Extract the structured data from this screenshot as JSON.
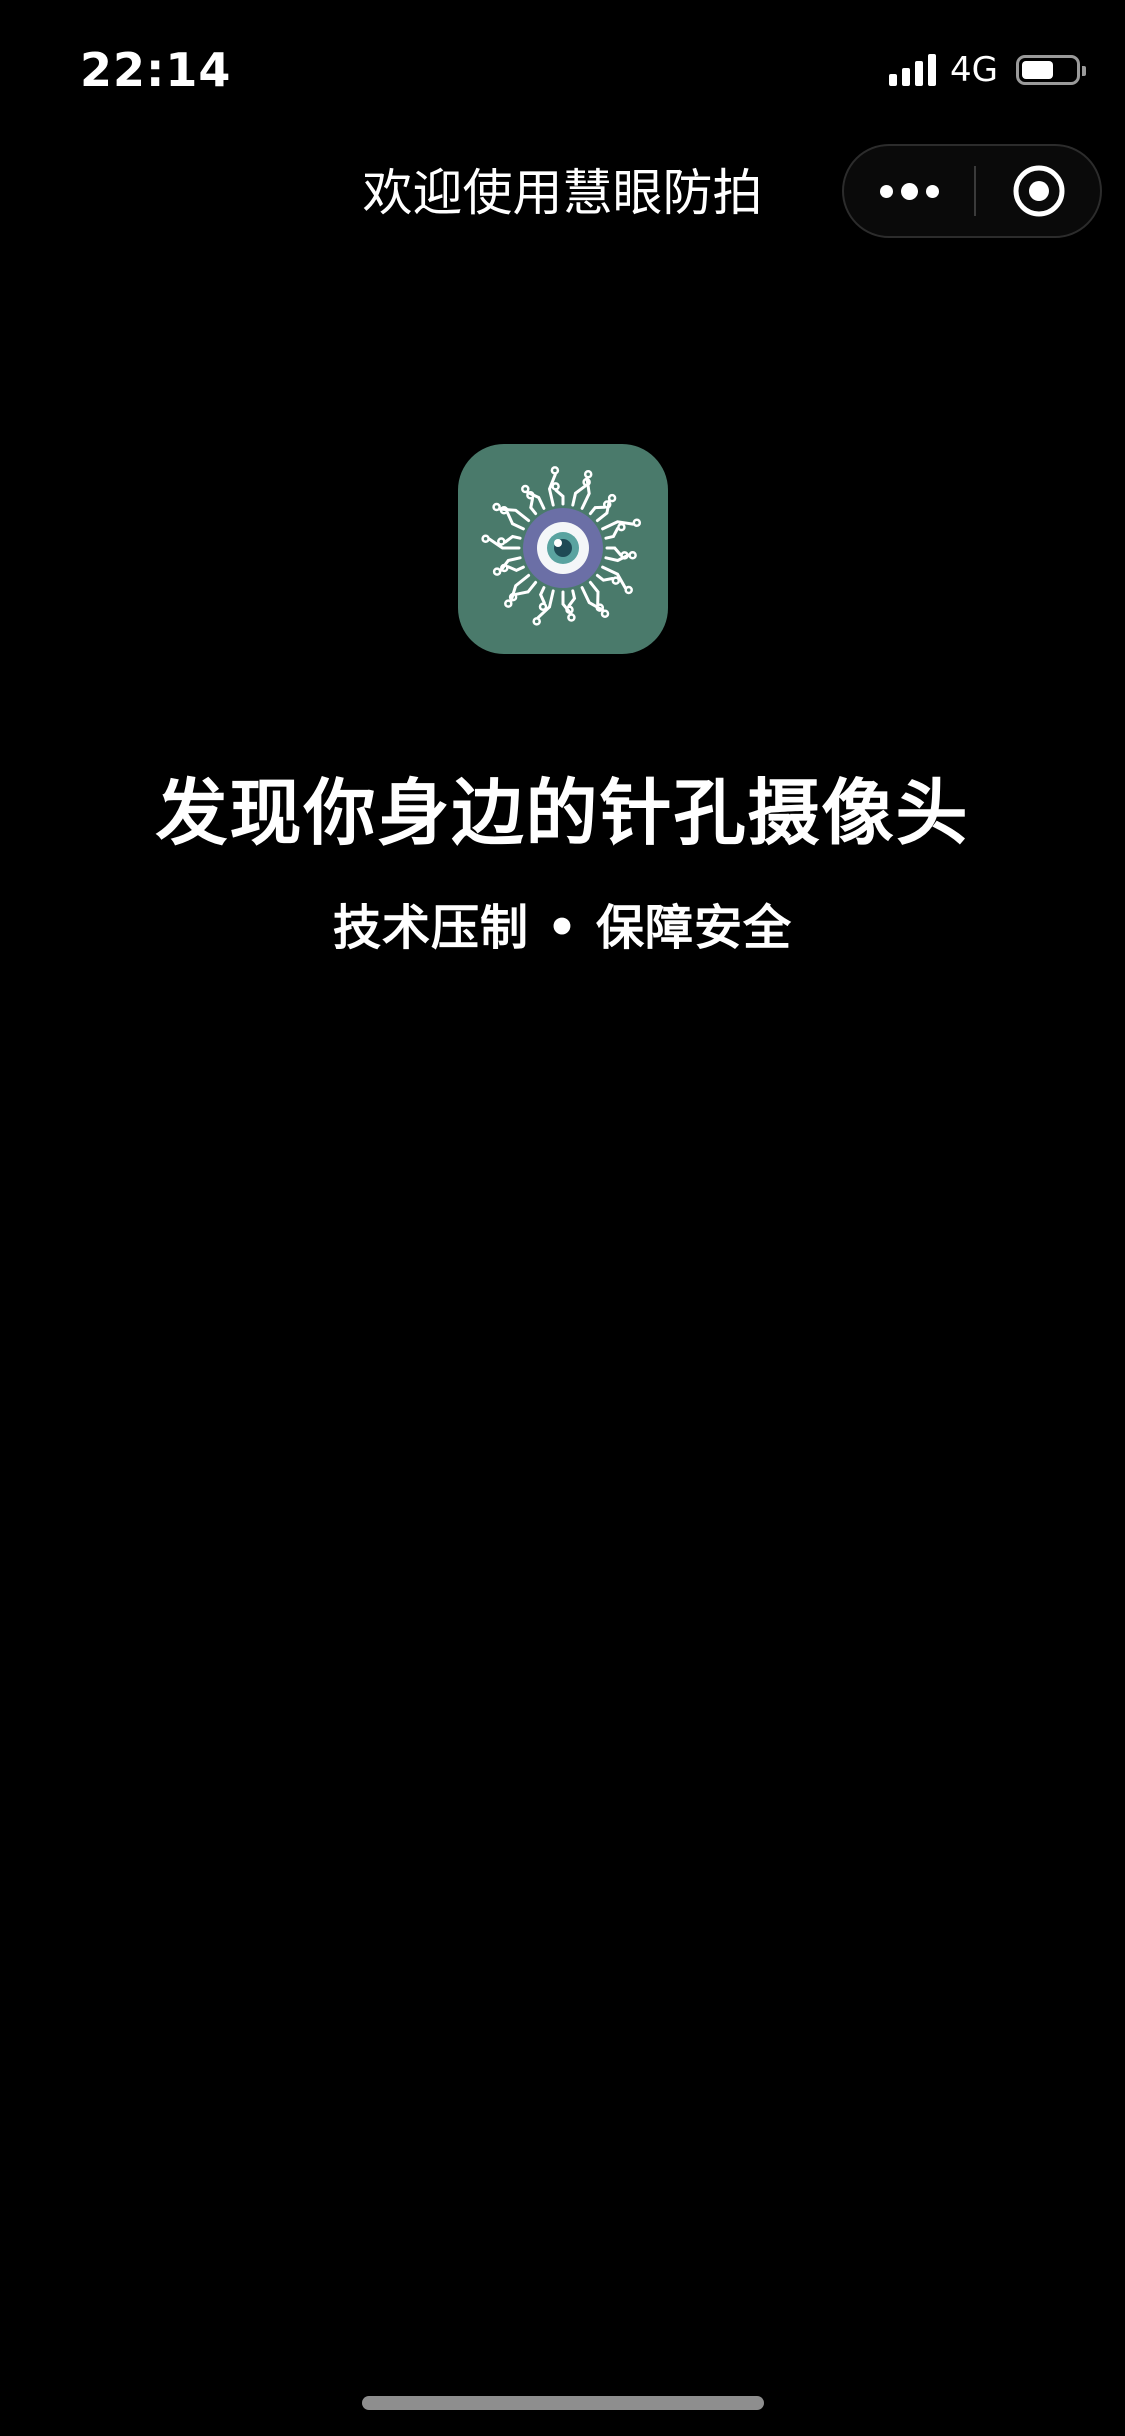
{
  "status_bar": {
    "time": "22:14",
    "network": "4G",
    "battery_level": 0.6,
    "signal_bars": 4
  },
  "nav": {
    "title": "欢迎使用慧眼防拍",
    "more_icon": "more-dots-icon",
    "close_icon": "target-close-icon"
  },
  "hero": {
    "app_icon": "eye-circuit-icon",
    "headline": "发现你身边的针孔摄像头",
    "subline": "技术压制 • 保障安全"
  },
  "colors": {
    "background": "#000000",
    "icon_background": "#4a7a6b",
    "iris": "#6b6fa6",
    "text": "#ffffff"
  }
}
